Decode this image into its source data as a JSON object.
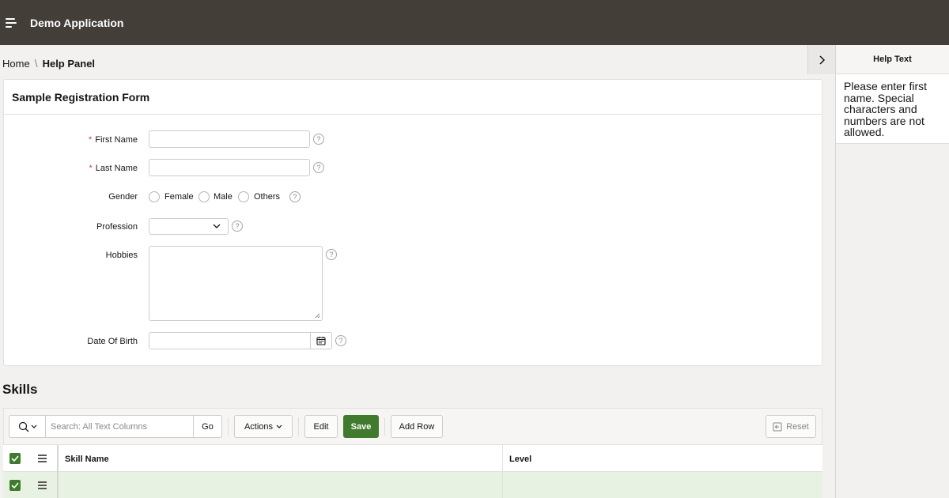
{
  "header": {
    "app_title": "Demo Application"
  },
  "breadcrumb": {
    "home": "Home",
    "separator": "\\",
    "current": "Help Panel"
  },
  "help_panel": {
    "title": "Help Text",
    "body": "Please enter first name. Special characters and numbers are not allowed."
  },
  "form": {
    "title": "Sample Registration Form",
    "first_name_label": "First Name",
    "last_name_label": "Last Name",
    "gender_label": "Gender",
    "gender_options": [
      "Female",
      "Male",
      "Others"
    ],
    "profession_label": "Profession",
    "hobbies_label": "Hobbies",
    "dob_label": "Date Of Birth",
    "required_marker": "*"
  },
  "skills": {
    "title": "Skills",
    "search_placeholder": "Search: All Text Columns",
    "go_label": "Go",
    "actions_label": "Actions",
    "edit_label": "Edit",
    "save_label": "Save",
    "add_row_label": "Add Row",
    "reset_label": "Reset",
    "columns": [
      "Skill Name",
      "Level"
    ]
  },
  "colors": {
    "header_bg": "#433e38",
    "primary_green": "#3f7a2d",
    "required_red": "#c74634",
    "selected_row": "#e8f2e3"
  }
}
